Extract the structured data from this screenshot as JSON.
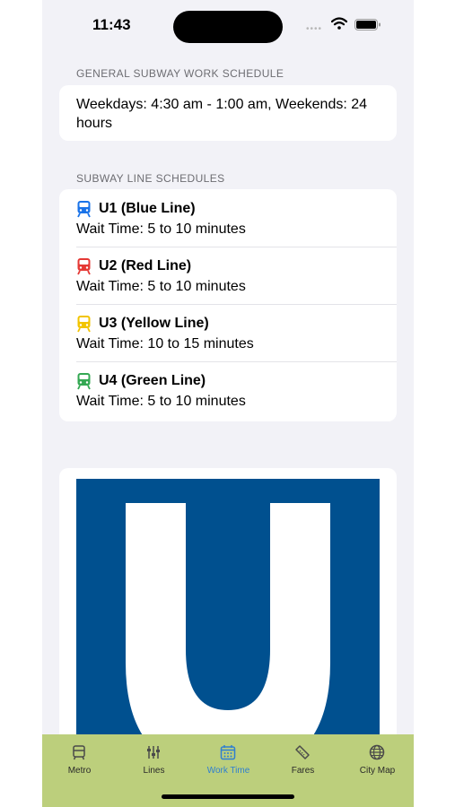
{
  "status_bar": {
    "time": "11:43"
  },
  "general": {
    "header": "GENERAL SUBWAY WORK SCHEDULE",
    "text": "Weekdays: 4:30 am - 1:00 am, Weekends: 24 hours"
  },
  "lines": {
    "header": "SUBWAY LINE SCHEDULES",
    "items": [
      {
        "name": "U1 (Blue Line)",
        "wait": "Wait Time: 5 to 10 minutes",
        "color": "#1a73e8",
        "icon": "tram-icon"
      },
      {
        "name": "U2 (Red Line)",
        "wait": "Wait Time: 5 to 10 minutes",
        "color": "#e53935",
        "icon": "tram-icon"
      },
      {
        "name": "U3 (Yellow Line)",
        "wait": "Wait Time: 10 to 15 minutes",
        "color": "#f2c400",
        "icon": "tram-icon"
      },
      {
        "name": "U4 (Green Line)",
        "wait": "Wait Time: 5 to 10 minutes",
        "color": "#34a853",
        "icon": "tram-icon"
      }
    ]
  },
  "logo": {
    "letter": "U",
    "background": "#00508f",
    "letter_color": "#ffffff"
  },
  "tab_bar": {
    "background": "#bccf7c",
    "active_color": "#2f7fd0",
    "tabs": [
      {
        "label": "Metro",
        "icon": "tram-icon",
        "active": false
      },
      {
        "label": "Lines",
        "icon": "sliders-icon",
        "active": false
      },
      {
        "label": "Work Time",
        "icon": "calendar-icon",
        "active": true
      },
      {
        "label": "Fares",
        "icon": "ticket-icon",
        "active": false
      },
      {
        "label": "City Map",
        "icon": "globe-icon",
        "active": false
      }
    ]
  }
}
